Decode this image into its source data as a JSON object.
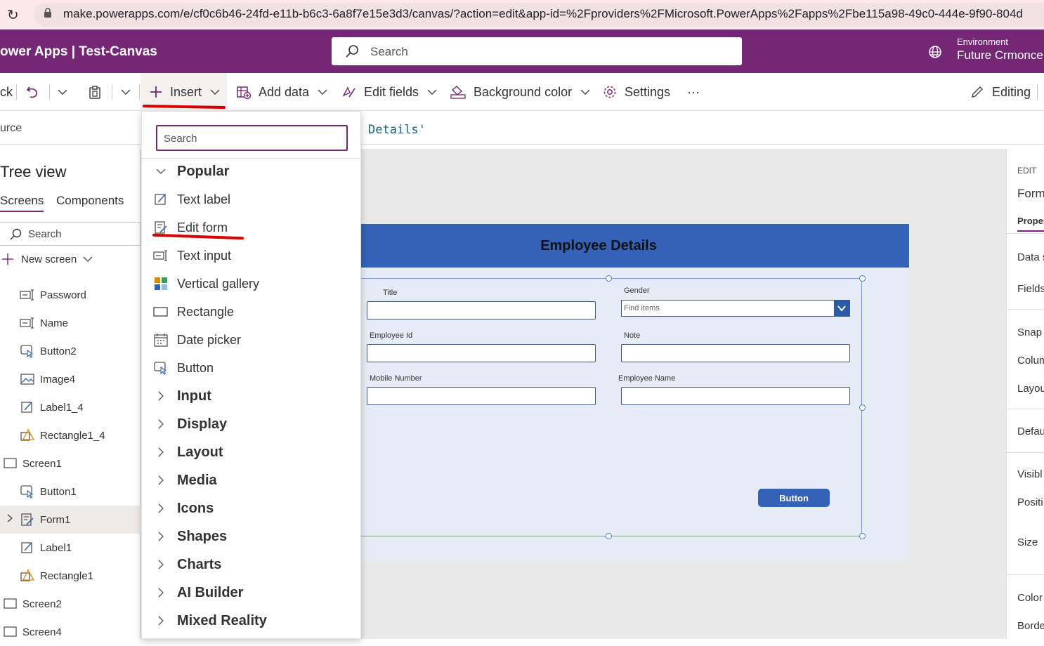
{
  "browser": {
    "url": "make.powerapps.com/e/cf0c6b46-24fd-e11b-b6c3-6a8f7e15e3d3/canvas/?action=edit&app-id=%2Fproviders%2FMicrosoft.PowerApps%2Fapps%2Fbe115a98-49c0-444e-9f90-804d"
  },
  "header": {
    "app_title": "ower Apps  |  Test-Canvas",
    "search_placeholder": "Search",
    "env_label": "Environment",
    "env_name": "Future Crmonce"
  },
  "cmdbar": {
    "back_label": "ck",
    "insert_label": "Insert",
    "add_data_label": "Add data",
    "edit_fields_label": "Edit fields",
    "background_color_label": "Background color",
    "settings_label": "Settings",
    "more_label": "···",
    "editing_label": "Editing"
  },
  "formula": {
    "property": "urce",
    "text": "Details'"
  },
  "tree": {
    "title": "Tree view",
    "tabs": [
      "Screens",
      "Components"
    ],
    "search_placeholder": "Search",
    "new_screen_label": "New screen",
    "items": [
      {
        "label": "Password",
        "icon": "text-input-icon"
      },
      {
        "label": "Name",
        "icon": "text-input-icon"
      },
      {
        "label": "Button2",
        "icon": "button-icon"
      },
      {
        "label": "Image4",
        "icon": "image-icon"
      },
      {
        "label": "Label1_4",
        "icon": "label-icon"
      },
      {
        "label": "Rectangle1_4",
        "icon": "shape-icon"
      },
      {
        "label": "Screen1",
        "icon": "screen-icon"
      },
      {
        "label": "Button1",
        "icon": "button-icon"
      },
      {
        "label": "Form1",
        "icon": "form-icon"
      },
      {
        "label": "Label1",
        "icon": "label-icon"
      },
      {
        "label": "Rectangle1",
        "icon": "shape-icon"
      },
      {
        "label": "Screen2",
        "icon": "screen-icon"
      },
      {
        "label": "Screen4",
        "icon": "screen-icon"
      }
    ]
  },
  "insert_menu": {
    "search_placeholder": "Search",
    "popular_label": "Popular",
    "popular_items": [
      "Text label",
      "Edit form",
      "Text input",
      "Vertical gallery",
      "Rectangle",
      "Date picker",
      "Button"
    ],
    "groups": [
      "Input",
      "Display",
      "Layout",
      "Media",
      "Icons",
      "Shapes",
      "Charts",
      "AI Builder",
      "Mixed Reality"
    ]
  },
  "canvas": {
    "screen_title": "Employee Details",
    "fields": {
      "title": "Title",
      "gender": "Gender",
      "gender_placeholder": "Find items",
      "employee_id": "Employee Id",
      "note": "Note",
      "mobile_number": "Mobile Number",
      "employee_name": "Employee Name"
    },
    "button_label": "Button"
  },
  "properties_pane": {
    "edit_label": "EDIT",
    "control_name": "Form",
    "tab_label": "Proper",
    "rows": [
      "Data s",
      "Fields",
      "Snap t",
      "Colum",
      "Layou",
      "Defau",
      "Visibl",
      "Positi",
      "Size",
      "Color",
      "Borde"
    ]
  },
  "colors": {
    "brand": "#742774",
    "screen_header": "#3462b7",
    "highlight_red": "#d60000"
  }
}
